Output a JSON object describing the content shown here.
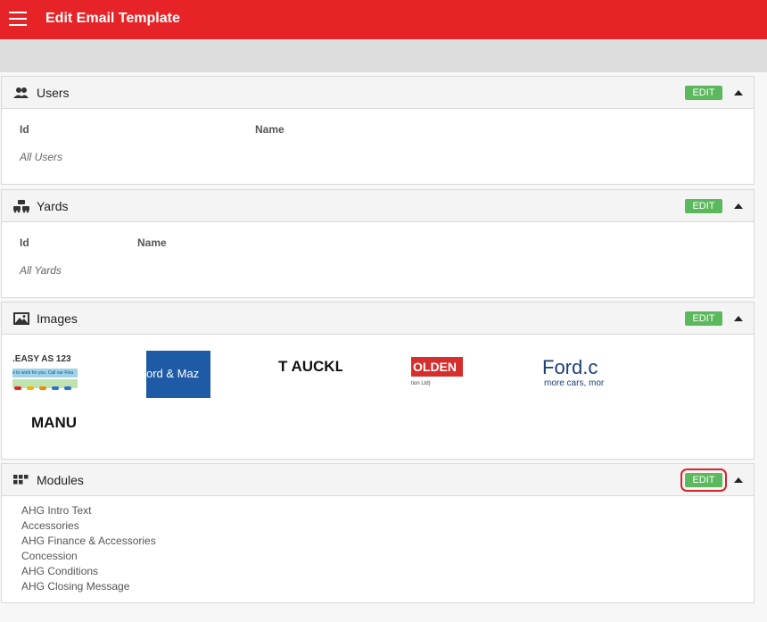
{
  "header": {
    "title": "Edit Email Template"
  },
  "users": {
    "title": "Users",
    "edit_label": "EDIT",
    "col_id": "Id",
    "col_name": "Name",
    "empty_text": "All Users"
  },
  "yards": {
    "title": "Yards",
    "edit_label": "EDIT",
    "col_id": "Id",
    "col_name": "Name",
    "empty_text": "All Yards"
  },
  "images": {
    "title": "Images",
    "edit_label": "EDIT",
    "tiles": [
      {
        "text": ".EASY AS 123",
        "sub": "e to work for you. Call our Fina"
      },
      {
        "text": "ord & Maz"
      },
      {
        "text": "T AUCKL"
      },
      {
        "text": "OLDEN",
        "sub": "tion Ltd)"
      },
      {
        "text": "Ford.c",
        "sub": "more cars, mor"
      },
      {
        "text": "MANU"
      }
    ]
  },
  "modules": {
    "title": "Modules",
    "edit_label": "EDIT",
    "items": [
      "AHG Intro Text",
      "Accessories",
      "AHG Finance & Accessories",
      "Concession",
      "AHG Conditions",
      "AHG Closing Message"
    ]
  },
  "colors": {
    "brand_red": "#e62428",
    "edit_green": "#5cb85c"
  }
}
